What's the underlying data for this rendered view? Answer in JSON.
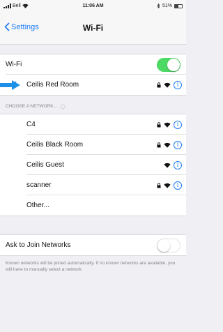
{
  "status_bar": {
    "carrier": "Bell",
    "time": "11:06 AM",
    "battery": "51%"
  },
  "nav": {
    "back_label": "Settings",
    "title": "Wi-Fi"
  },
  "wifi": {
    "label": "Wi-Fi",
    "enabled": true,
    "connected_network": "Ceilis Red Room"
  },
  "networks_header": "CHOOSE A NETWORK...",
  "networks": [
    {
      "name": "C4",
      "locked": true
    },
    {
      "name": "Ceilis Black Room",
      "locked": true
    },
    {
      "name": "Ceilis Guest",
      "locked": false
    },
    {
      "name": "scanner",
      "locked": true
    }
  ],
  "other_label": "Other...",
  "ask_to_join": {
    "label": "Ask to Join Networks",
    "enabled": false,
    "note": "Known networks will be joined automatically. If no known networks are available, you will have to manually select a network."
  },
  "colors": {
    "accent": "#1a7cf5",
    "toggle_on": "#4cd964",
    "annotation_arrow": "#1e90e8"
  }
}
